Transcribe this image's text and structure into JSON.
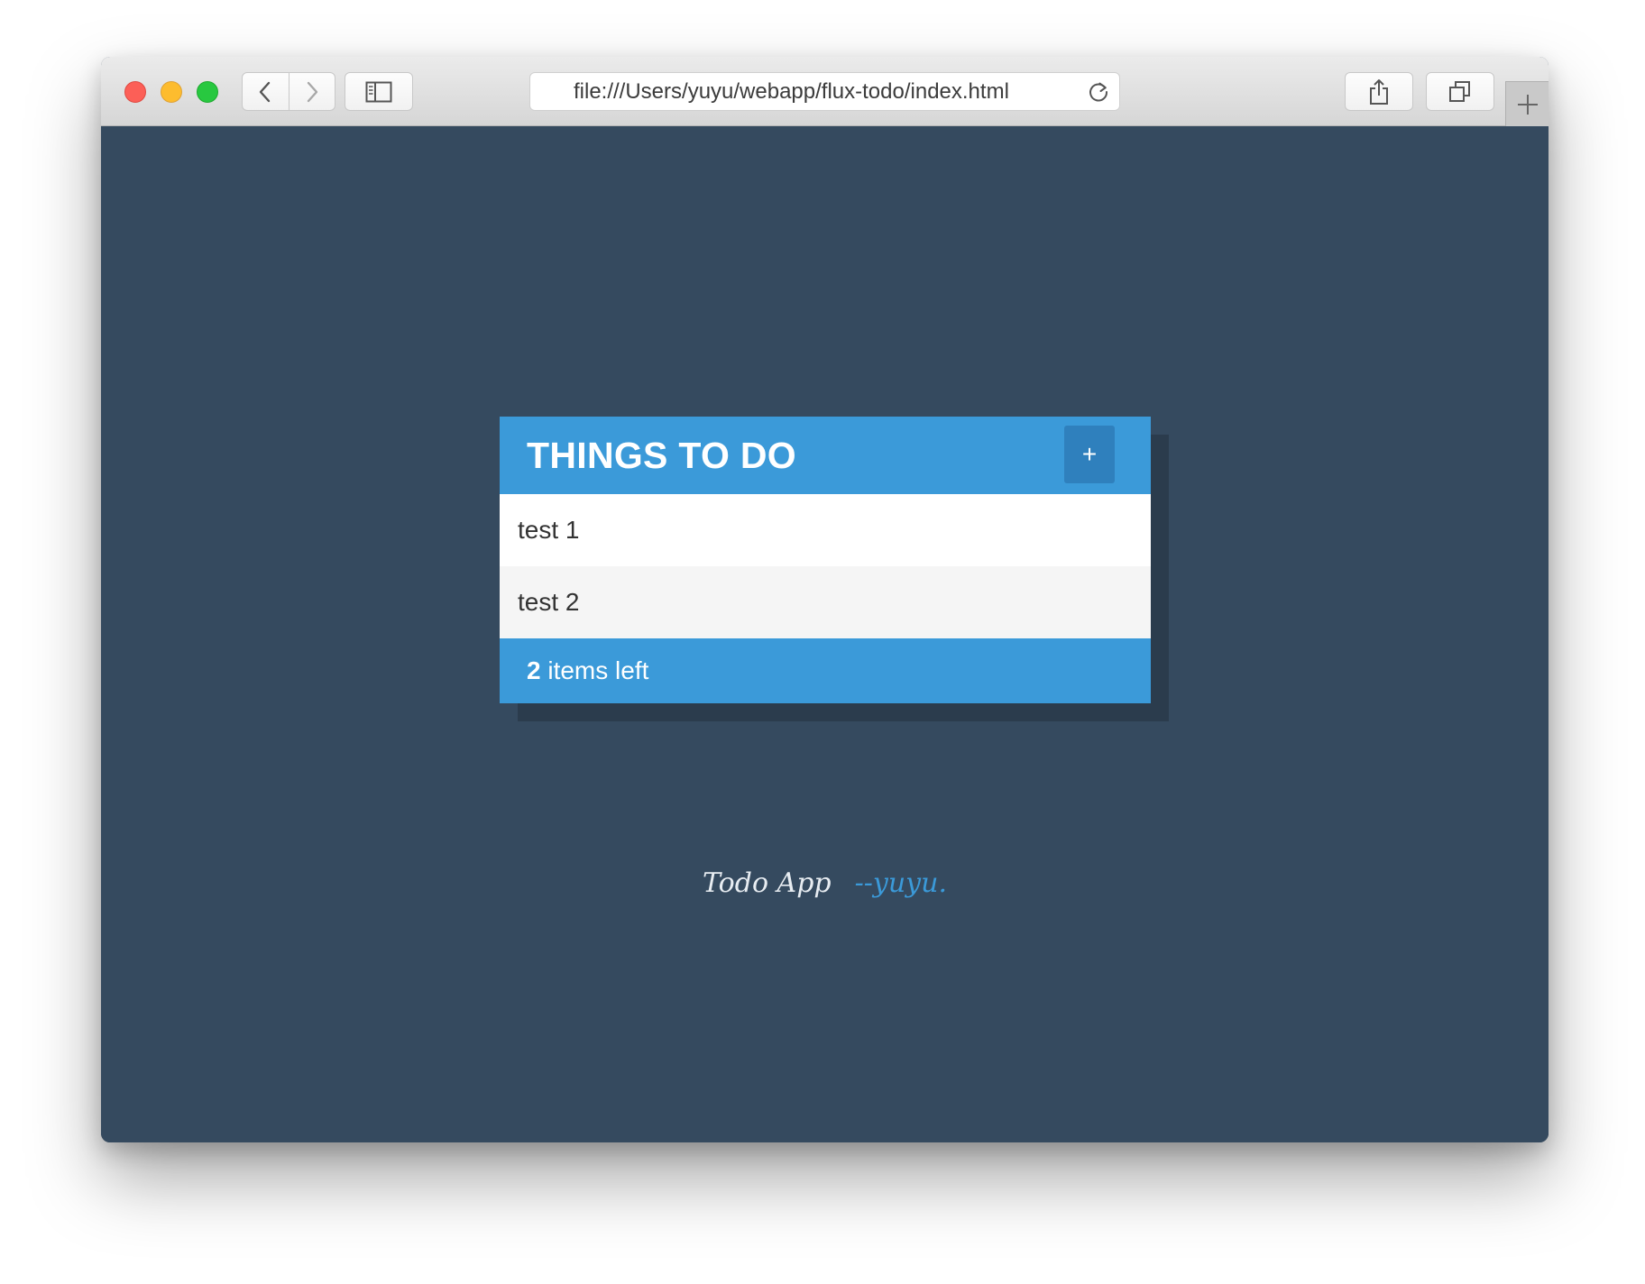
{
  "browser": {
    "url": "file:///Users/yuyu/webapp/flux-todo/index.html"
  },
  "todo": {
    "title": "THINGS TO DO",
    "add_label": "+",
    "items": [
      {
        "text": "test 1"
      },
      {
        "text": "test 2"
      }
    ],
    "footer": {
      "count": "2",
      "suffix": " items left"
    }
  },
  "credits": {
    "app_name": "Todo App",
    "author": "--yuyu."
  },
  "colors": {
    "background": "#354a5f",
    "accent": "#3b9ad9",
    "accent_dark": "#2f80bd"
  },
  "icons": {
    "close": "close-window-icon",
    "minimize": "minimize-window-icon",
    "zoom": "zoom-window-icon",
    "back": "chevron-left-icon",
    "forward": "chevron-right-icon",
    "sidebar": "sidebar-icon",
    "reload": "reload-icon",
    "share": "share-icon",
    "tabs": "tabs-overview-icon",
    "new_tab": "plus-icon"
  }
}
